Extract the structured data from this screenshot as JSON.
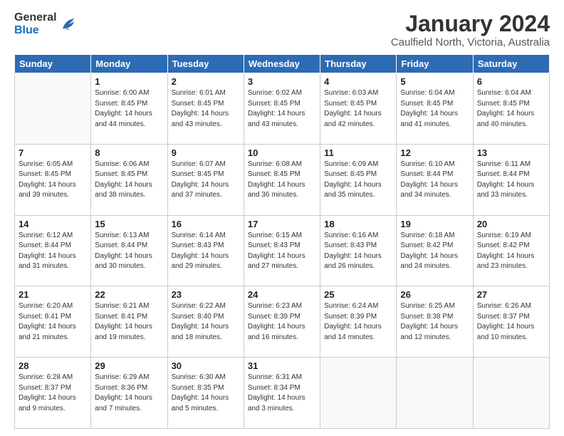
{
  "logo": {
    "general": "General",
    "blue": "Blue"
  },
  "header": {
    "title": "January 2024",
    "subtitle": "Caulfield North, Victoria, Australia"
  },
  "weekdays": [
    "Sunday",
    "Monday",
    "Tuesday",
    "Wednesday",
    "Thursday",
    "Friday",
    "Saturday"
  ],
  "weeks": [
    [
      {
        "day": "",
        "info": ""
      },
      {
        "day": "1",
        "info": "Sunrise: 6:00 AM\nSunset: 8:45 PM\nDaylight: 14 hours\nand 44 minutes."
      },
      {
        "day": "2",
        "info": "Sunrise: 6:01 AM\nSunset: 8:45 PM\nDaylight: 14 hours\nand 43 minutes."
      },
      {
        "day": "3",
        "info": "Sunrise: 6:02 AM\nSunset: 8:45 PM\nDaylight: 14 hours\nand 43 minutes."
      },
      {
        "day": "4",
        "info": "Sunrise: 6:03 AM\nSunset: 8:45 PM\nDaylight: 14 hours\nand 42 minutes."
      },
      {
        "day": "5",
        "info": "Sunrise: 6:04 AM\nSunset: 8:45 PM\nDaylight: 14 hours\nand 41 minutes."
      },
      {
        "day": "6",
        "info": "Sunrise: 6:04 AM\nSunset: 8:45 PM\nDaylight: 14 hours\nand 40 minutes."
      }
    ],
    [
      {
        "day": "7",
        "info": "Sunrise: 6:05 AM\nSunset: 8:45 PM\nDaylight: 14 hours\nand 39 minutes."
      },
      {
        "day": "8",
        "info": "Sunrise: 6:06 AM\nSunset: 8:45 PM\nDaylight: 14 hours\nand 38 minutes."
      },
      {
        "day": "9",
        "info": "Sunrise: 6:07 AM\nSunset: 8:45 PM\nDaylight: 14 hours\nand 37 minutes."
      },
      {
        "day": "10",
        "info": "Sunrise: 6:08 AM\nSunset: 8:45 PM\nDaylight: 14 hours\nand 36 minutes."
      },
      {
        "day": "11",
        "info": "Sunrise: 6:09 AM\nSunset: 8:45 PM\nDaylight: 14 hours\nand 35 minutes."
      },
      {
        "day": "12",
        "info": "Sunrise: 6:10 AM\nSunset: 8:44 PM\nDaylight: 14 hours\nand 34 minutes."
      },
      {
        "day": "13",
        "info": "Sunrise: 6:11 AM\nSunset: 8:44 PM\nDaylight: 14 hours\nand 33 minutes."
      }
    ],
    [
      {
        "day": "14",
        "info": "Sunrise: 6:12 AM\nSunset: 8:44 PM\nDaylight: 14 hours\nand 31 minutes."
      },
      {
        "day": "15",
        "info": "Sunrise: 6:13 AM\nSunset: 8:44 PM\nDaylight: 14 hours\nand 30 minutes."
      },
      {
        "day": "16",
        "info": "Sunrise: 6:14 AM\nSunset: 8:43 PM\nDaylight: 14 hours\nand 29 minutes."
      },
      {
        "day": "17",
        "info": "Sunrise: 6:15 AM\nSunset: 8:43 PM\nDaylight: 14 hours\nand 27 minutes."
      },
      {
        "day": "18",
        "info": "Sunrise: 6:16 AM\nSunset: 8:43 PM\nDaylight: 14 hours\nand 26 minutes."
      },
      {
        "day": "19",
        "info": "Sunrise: 6:18 AM\nSunset: 8:42 PM\nDaylight: 14 hours\nand 24 minutes."
      },
      {
        "day": "20",
        "info": "Sunrise: 6:19 AM\nSunset: 8:42 PM\nDaylight: 14 hours\nand 23 minutes."
      }
    ],
    [
      {
        "day": "21",
        "info": "Sunrise: 6:20 AM\nSunset: 8:41 PM\nDaylight: 14 hours\nand 21 minutes."
      },
      {
        "day": "22",
        "info": "Sunrise: 6:21 AM\nSunset: 8:41 PM\nDaylight: 14 hours\nand 19 minutes."
      },
      {
        "day": "23",
        "info": "Sunrise: 6:22 AM\nSunset: 8:40 PM\nDaylight: 14 hours\nand 18 minutes."
      },
      {
        "day": "24",
        "info": "Sunrise: 6:23 AM\nSunset: 8:39 PM\nDaylight: 14 hours\nand 16 minutes."
      },
      {
        "day": "25",
        "info": "Sunrise: 6:24 AM\nSunset: 8:39 PM\nDaylight: 14 hours\nand 14 minutes."
      },
      {
        "day": "26",
        "info": "Sunrise: 6:25 AM\nSunset: 8:38 PM\nDaylight: 14 hours\nand 12 minutes."
      },
      {
        "day": "27",
        "info": "Sunrise: 6:26 AM\nSunset: 8:37 PM\nDaylight: 14 hours\nand 10 minutes."
      }
    ],
    [
      {
        "day": "28",
        "info": "Sunrise: 6:28 AM\nSunset: 8:37 PM\nDaylight: 14 hours\nand 9 minutes."
      },
      {
        "day": "29",
        "info": "Sunrise: 6:29 AM\nSunset: 8:36 PM\nDaylight: 14 hours\nand 7 minutes."
      },
      {
        "day": "30",
        "info": "Sunrise: 6:30 AM\nSunset: 8:35 PM\nDaylight: 14 hours\nand 5 minutes."
      },
      {
        "day": "31",
        "info": "Sunrise: 6:31 AM\nSunset: 8:34 PM\nDaylight: 14 hours\nand 3 minutes."
      },
      {
        "day": "",
        "info": ""
      },
      {
        "day": "",
        "info": ""
      },
      {
        "day": "",
        "info": ""
      }
    ]
  ]
}
